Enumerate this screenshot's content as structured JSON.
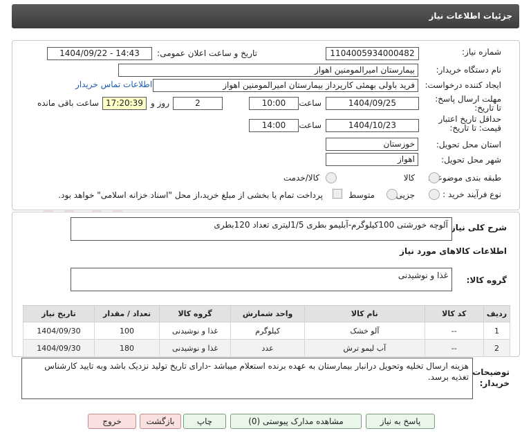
{
  "header": {
    "title": "جزئیات اطلاعات نیاز"
  },
  "fields": {
    "need_number_label": "شماره نیاز:",
    "need_number": "1104005934000482",
    "announce_label": "تاریخ و ساعت اعلان عمومی:",
    "announce_value": "1404/09/22 - 14:43",
    "buyer_org_label": "نام دستگاه خریدار:",
    "buyer_org": "بیمارستان امیرالمومنین اهواز",
    "creator_label": "ایجاد کننده درخواست:",
    "creator": "فرید باولی بهمئی کارپرداز بیمارستان امیرالمومنین اهواز",
    "contact_link": "اطلاعات تماس خریدار",
    "deadline_label": "مهلت ارسال پاسخ: تا تاریخ:",
    "deadline_date": "1404/09/25",
    "time_label": "ساعت",
    "deadline_time": "10:00",
    "days_value": "2",
    "days_label": "روز و",
    "remaining_time": "17:20:39",
    "remaining_label": "ساعت باقی مانده",
    "validity_label": "حداقل تاریخ اعتبار قیمت: تا تاریخ:",
    "validity_date": "1404/10/23",
    "validity_time": "14:00",
    "province_label": "استان محل تحویل:",
    "province": "خوزستان",
    "city_label": "شهر محل تحویل:",
    "city": "اهواز",
    "category_label": "طبقه بندی موضوعی:",
    "category_opt1": "کالا",
    "category_opt2": "کالا/خدمت",
    "process_label": "نوع فرآیند خرید :",
    "process_opt1": "جزیی",
    "process_opt2": "متوسط",
    "payment_note": "پرداخت تمام یا بخشی از مبلغ خرید،از محل \"اسناد خزانه اسلامی\" خواهد بود."
  },
  "summary": {
    "label": "شرح کلی نیاز:",
    "text": "آلوچه خورشتی 100کیلوگرم-آبلیمو بطری 1/5لیتری تعداد 120بطری"
  },
  "goods_info_title": "اطلاعات کالاهای مورد نیاز",
  "goods_group": {
    "label": "گروه کالا:",
    "value": "غذا و نوشیدنی"
  },
  "table": {
    "headers": [
      "ردیف",
      "کد کالا",
      "نام کالا",
      "واحد شمارش",
      "گروه کالا",
      "تعداد / مقدار",
      "تاریخ نیاز"
    ],
    "rows": [
      [
        "1",
        "--",
        "آلو خشک",
        "کیلوگرم",
        "غذا و نوشیدنی",
        "100",
        "1404/09/30"
      ],
      [
        "2",
        "--",
        "آب لیمو ترش",
        "عدد",
        "غذا و نوشیدنی",
        "180",
        "1404/09/30"
      ]
    ]
  },
  "buyer_notes": {
    "label": "توضیحات خریدار:",
    "text": "هزینه ارسال تخلیه وتحویل درانبار بیمارستان به عهده برنده استعلام میباشد -دارای تاریخ تولید نزدیک باشد وبه تایید کارشناس تغذیه برسد."
  },
  "buttons": {
    "reply": "پاسخ به نیاز",
    "attachments": "مشاهده مدارک پیوستی (0)",
    "print": "چاپ",
    "back": "بازگشت",
    "exit": "خروج"
  },
  "colors": {
    "header": "#4a4a4a",
    "link": "#1a5fb4",
    "highlight": "#ffffc8"
  }
}
